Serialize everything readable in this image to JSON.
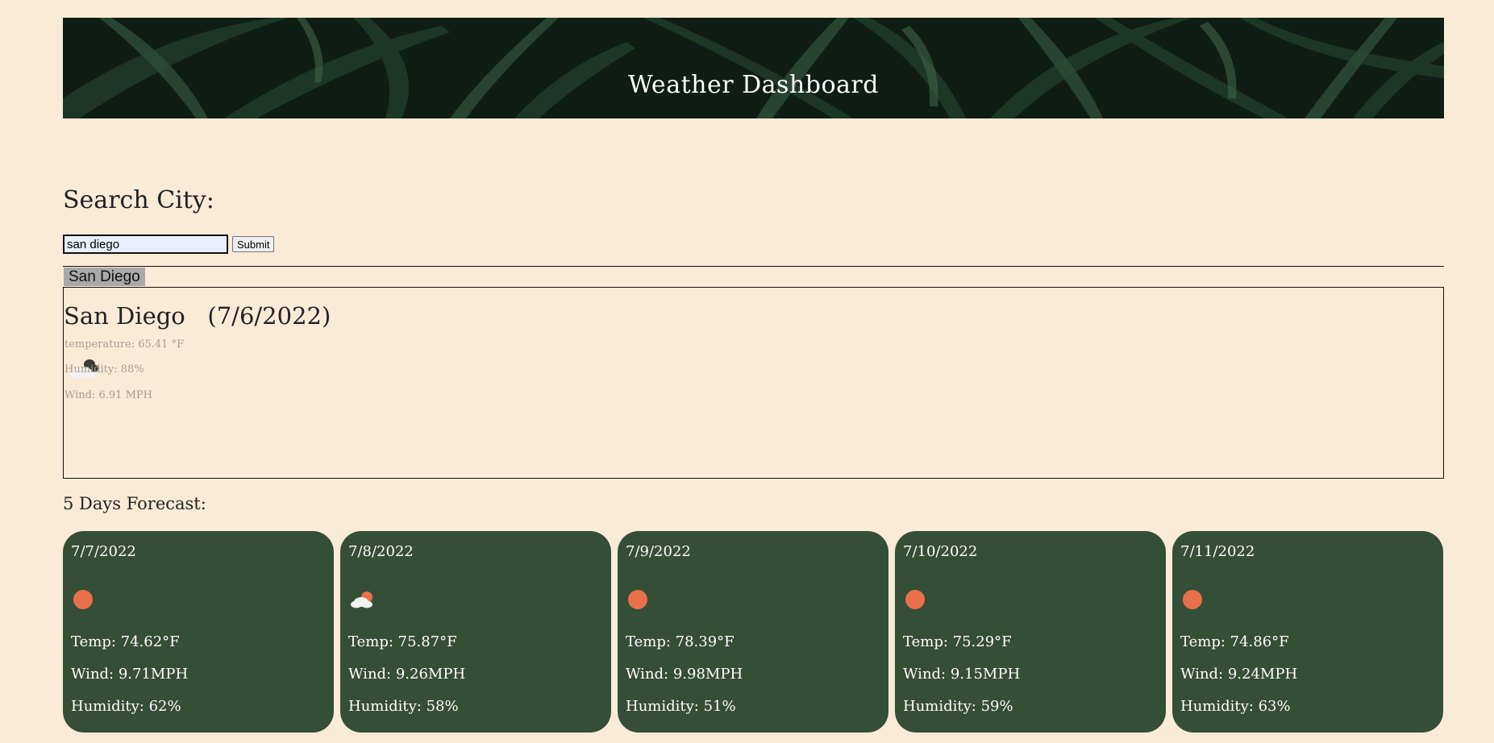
{
  "header": {
    "title": "Weather Dashboard"
  },
  "search": {
    "label": "Search City:",
    "value": "san diego",
    "submit_label": "Submit"
  },
  "history": [
    "San Diego"
  ],
  "current": {
    "title": "San Diego   (7/6/2022)",
    "icon": "cloudy-icon",
    "temperature": "temperature: 65.41 °F",
    "humidity": "Humidity: 88%",
    "wind": "Wind: 6.91 MPH"
  },
  "forecast": {
    "label": "5 Days Forecast:",
    "days": [
      {
        "date": "7/7/2022",
        "icon": "sun-icon",
        "temp": "Temp: 74.62°F",
        "wind": "Wind: 9.71MPH",
        "humidity": "Humidity: 62%"
      },
      {
        "date": "7/8/2022",
        "icon": "partly-cloudy-icon",
        "temp": "Temp: 75.87°F",
        "wind": "Wind: 9.26MPH",
        "humidity": "Humidity: 58%"
      },
      {
        "date": "7/9/2022",
        "icon": "sun-icon",
        "temp": "Temp: 78.39°F",
        "wind": "Wind: 9.98MPH",
        "humidity": "Humidity: 51%"
      },
      {
        "date": "7/10/2022",
        "icon": "sun-icon",
        "temp": "Temp: 75.29°F",
        "wind": "Wind: 9.15MPH",
        "humidity": "Humidity: 59%"
      },
      {
        "date": "7/11/2022",
        "icon": "sun-icon",
        "temp": "Temp: 74.86°F",
        "wind": "Wind: 9.24MPH",
        "humidity": "Humidity: 63%"
      }
    ]
  },
  "colors": {
    "page_background": "#faebd7",
    "card_background": "#354e36",
    "sun": "#e8704a",
    "history_button": "#a9a9a9"
  }
}
